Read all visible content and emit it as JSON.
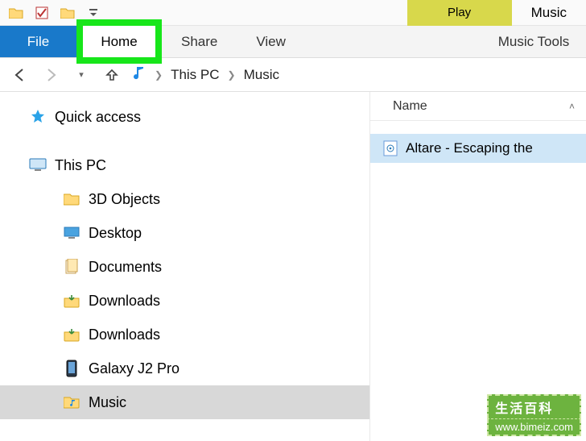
{
  "titlebar": {
    "play_label": "Play",
    "window_title": "Music"
  },
  "ribbon": {
    "file": "File",
    "home": "Home",
    "share": "Share",
    "view": "View",
    "music_tools": "Music Tools"
  },
  "breadcrumb": {
    "root": "This PC",
    "current": "Music"
  },
  "sidebar": {
    "quick_access": "Quick access",
    "this_pc": "This PC",
    "items": [
      {
        "label": "3D Objects"
      },
      {
        "label": "Desktop"
      },
      {
        "label": "Documents"
      },
      {
        "label": "Downloads"
      },
      {
        "label": "Downloads"
      },
      {
        "label": "Galaxy J2 Pro"
      },
      {
        "label": "Music"
      }
    ]
  },
  "content": {
    "column_header": "Name",
    "files": [
      {
        "name": "Altare - Escaping the"
      }
    ]
  },
  "watermark": {
    "line1": "生活百科",
    "line2": "www.bimeiz.com"
  }
}
